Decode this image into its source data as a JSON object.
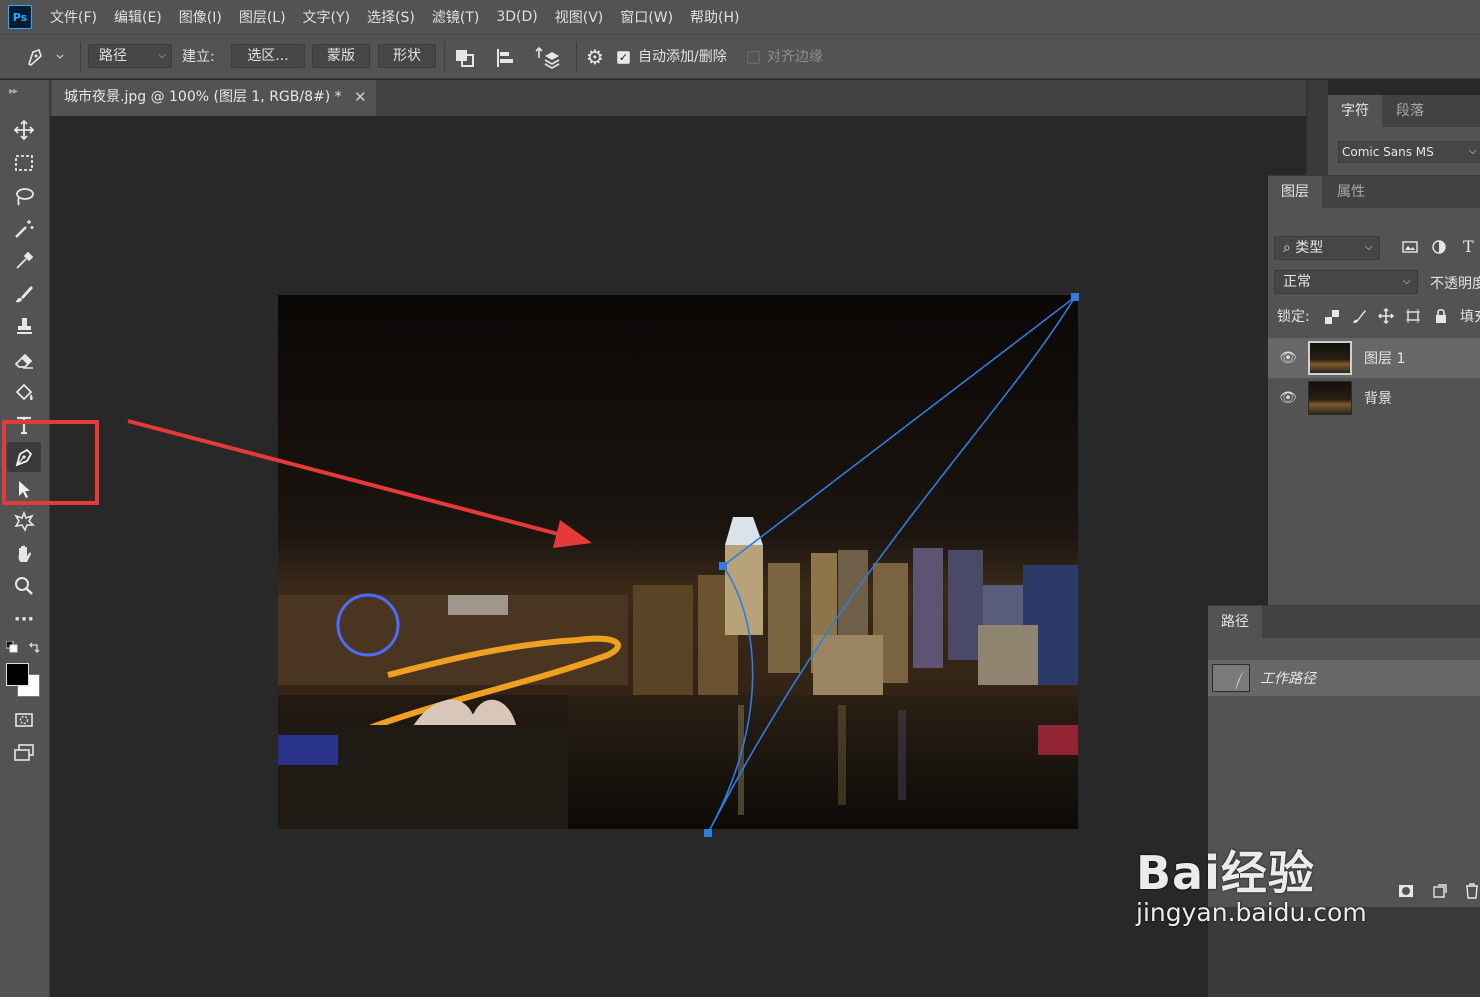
{
  "app": {
    "logo_text": "Ps"
  },
  "menu": [
    "文件(F)",
    "编辑(E)",
    "图像(I)",
    "图层(L)",
    "文字(Y)",
    "选择(S)",
    "滤镜(T)",
    "3D(D)",
    "视图(V)",
    "窗口(W)",
    "帮助(H)"
  ],
  "options_bar": {
    "mode": "路径",
    "make_label": "建立:",
    "selection_button": "选区...",
    "mask_button": "蒙版",
    "shape_button": "形状",
    "auto_add_delete": {
      "label": "自动添加/删除",
      "checked": true
    },
    "align_edges": {
      "label": "对齐边缘",
      "checked": false
    }
  },
  "document": {
    "tab_title": "城市夜景.jpg @ 100% (图层 1, RGB/8#) *"
  },
  "toolbar": {
    "tools": [
      "move-tool",
      "marquee-tool",
      "lasso-tool",
      "magic-wand-tool",
      "eyedropper-tool",
      "brush-tool",
      "clone-stamp-tool",
      "eraser-tool",
      "paint-bucket-tool",
      "type-tool",
      "pen-tool",
      "path-selection-tool",
      "custom-shape-tool",
      "hand-tool",
      "zoom-tool",
      "more-tools"
    ],
    "active_tool": "pen-tool",
    "foreground_color": "#000000",
    "background_color": "#ffffff"
  },
  "character_panel": {
    "tabs": [
      "字符",
      "段落"
    ],
    "font": "Comic Sans MS"
  },
  "layers_panel": {
    "tabs": [
      "图层",
      "属性"
    ],
    "filter_kind": "类型",
    "blend_mode": "正常",
    "opacity_label": "不透明度",
    "lock_label": "锁定:",
    "fill_label": "填充",
    "layers": [
      {
        "name": "图层 1",
        "visible": true,
        "selected": true
      },
      {
        "name": "背景",
        "visible": true,
        "selected": false
      }
    ]
  },
  "paths_panel": {
    "tab": "路径",
    "paths": [
      {
        "name": "工作路径",
        "selected": true
      }
    ]
  },
  "watermark": {
    "logo": "Bai经验",
    "url": "jingyan.baidu.com"
  },
  "colors": {
    "path_stroke": "#2f7de1",
    "annotation": "#e5393a",
    "ui_panel": "#535353",
    "canvas_bg": "#282828"
  }
}
